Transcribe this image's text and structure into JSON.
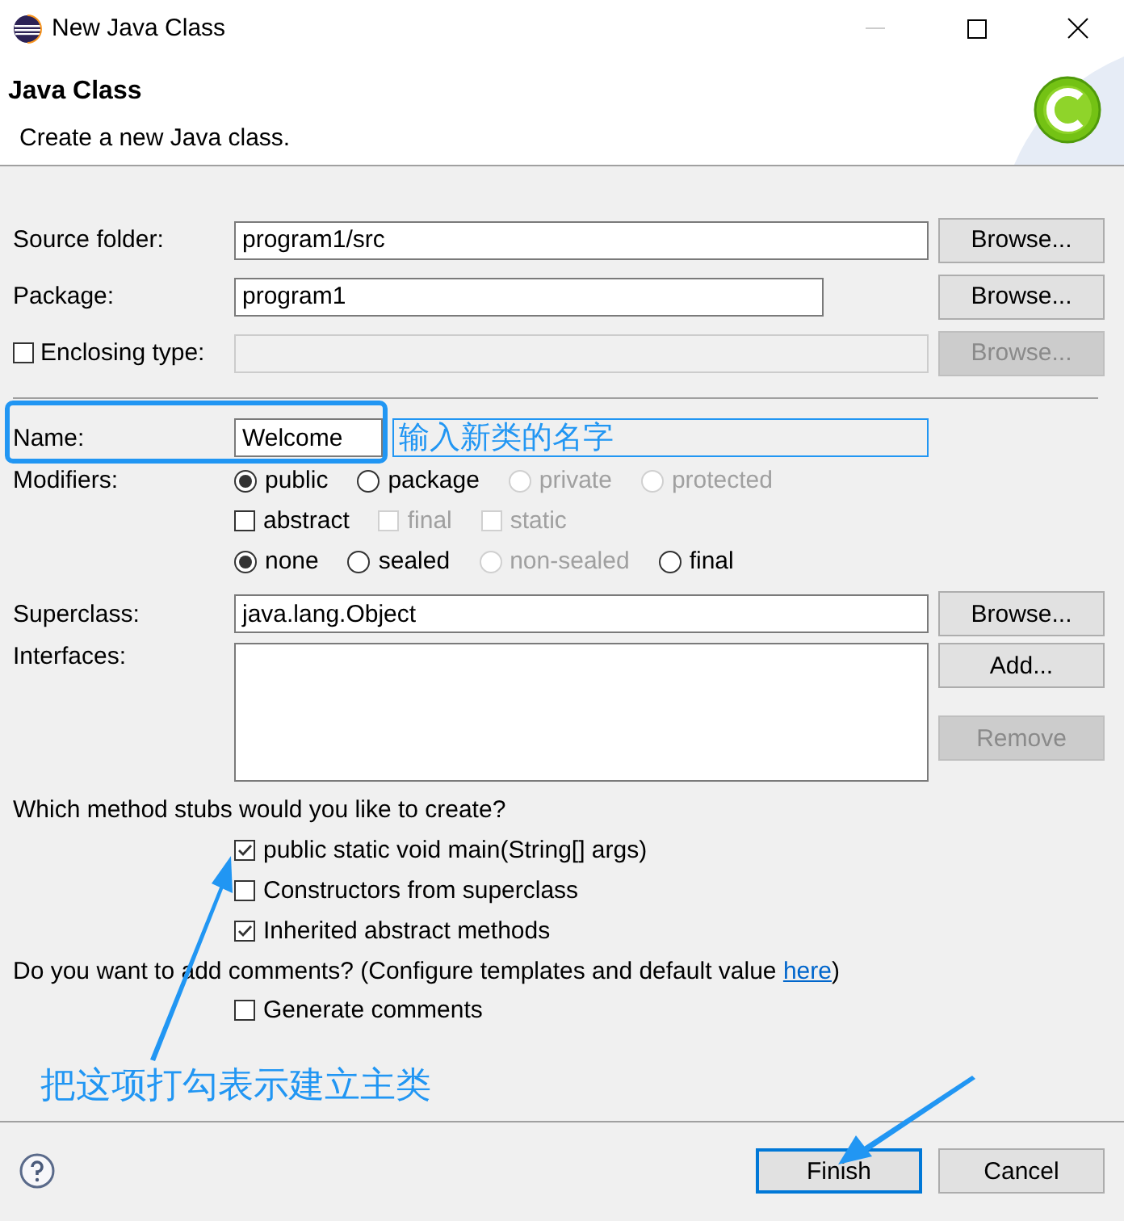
{
  "window": {
    "title": "New Java Class"
  },
  "header": {
    "title": "Java Class",
    "description": "Create a new Java class."
  },
  "location_fields": [
    {
      "kind": "text",
      "label": "Source folder:",
      "value": "program1/src",
      "button": {
        "label": "Browse...",
        "disabled": false
      }
    },
    {
      "kind": "text",
      "label": "Package:",
      "value": "program1",
      "button": {
        "label": "Browse...",
        "disabled": false
      }
    },
    {
      "kind": "checkbox",
      "label": "Enclosing type:",
      "checked": false,
      "button": {
        "label": "Browse...",
        "disabled": true
      }
    }
  ],
  "name": {
    "label": "Name:",
    "value": "Welcome",
    "annotation": "输入新类的名字"
  },
  "modifiers": {
    "label": "Modifiers:",
    "rows": [
      [
        {
          "kind": "radio",
          "label": "public",
          "selected": true,
          "disabled": false
        },
        {
          "kind": "radio",
          "label": "package",
          "selected": false,
          "disabled": false
        },
        {
          "kind": "radio",
          "label": "private",
          "selected": false,
          "disabled": true
        },
        {
          "kind": "radio",
          "label": "protected",
          "selected": false,
          "disabled": true
        }
      ],
      [
        {
          "kind": "checkbox",
          "label": "abstract",
          "checked": false,
          "disabled": false
        },
        {
          "kind": "checkbox",
          "label": "final",
          "checked": false,
          "disabled": true
        },
        {
          "kind": "checkbox",
          "label": "static",
          "checked": false,
          "disabled": true
        }
      ],
      [
        {
          "kind": "radio",
          "label": "none",
          "selected": true,
          "disabled": false
        },
        {
          "kind": "radio",
          "label": "sealed",
          "selected": false,
          "disabled": false
        },
        {
          "kind": "radio",
          "label": "non-sealed",
          "selected": false,
          "disabled": true
        },
        {
          "kind": "radio",
          "label": "final",
          "selected": false,
          "disabled": false
        }
      ]
    ]
  },
  "superclass": {
    "label": "Superclass:",
    "value": "java.lang.Object",
    "button": "Browse..."
  },
  "interfaces": {
    "label": "Interfaces:",
    "buttons": [
      {
        "label": "Add...",
        "disabled": false
      },
      {
        "label": "Remove",
        "disabled": true
      }
    ]
  },
  "stubs": {
    "question": "Which method stubs would you like to create?",
    "options": [
      {
        "label": "public static void main(String[] args)",
        "checked": true
      },
      {
        "label": "Constructors from superclass",
        "checked": false
      },
      {
        "label": "Inherited abstract methods",
        "checked": true
      }
    ]
  },
  "comments": {
    "question": "Do you want to add comments? (Configure templates and default value",
    "link": "here",
    "question_end": ")",
    "option": {
      "label": "Generate comments",
      "checked": false
    }
  },
  "footer_annotation": "把这项打勾表示建立主类",
  "buttons": [
    {
      "label": "Finish",
      "default": true
    },
    {
      "label": "Cancel",
      "default": false
    }
  ]
}
